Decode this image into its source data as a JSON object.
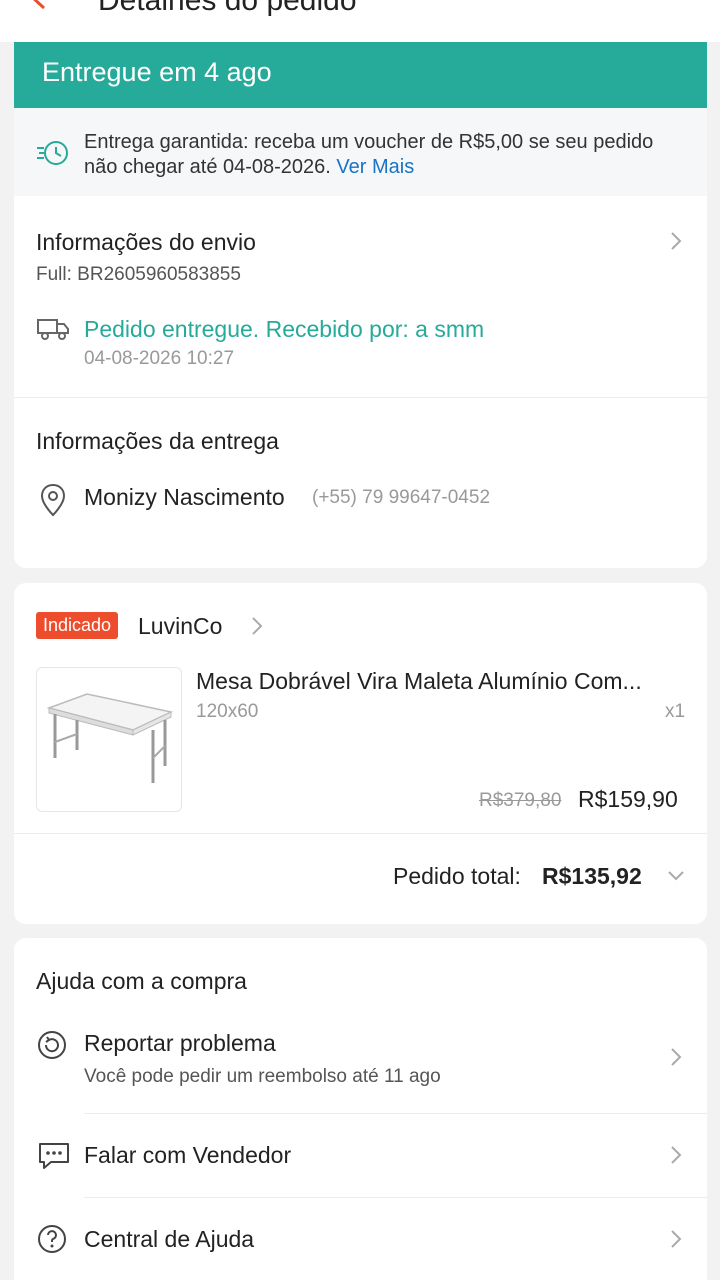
{
  "header": {
    "title": "Detalhes do pedido",
    "back_icon": "chevron-left-icon"
  },
  "status": {
    "text": "Entregue em 4 ago",
    "color": "#26aa99"
  },
  "guarantee": {
    "text": "Entrega garantida: receba um voucher de R$5,00 se seu pedido não chegar até 04-08-2026.",
    "link": "Ver Mais"
  },
  "shipping": {
    "title": "Informações do envio",
    "tracking": "Full: BR2605960583855",
    "event": "Pedido entregue. Recebido por: a smm",
    "event_time": "04-08-2026 10:27"
  },
  "delivery": {
    "title": "Informações da entrega",
    "name": "Monizy Nascimento",
    "phone": "(+55) 79 99647-0452"
  },
  "order": {
    "badge": "Indicado",
    "shop": "LuvinCo",
    "product": {
      "name": "Mesa Dobrável Vira Maleta Alumínio Com...",
      "variant": "120x60",
      "qty": "x1",
      "old_price": "R$379,80",
      "price": "R$159,90"
    },
    "total_label": "Pedido total:",
    "total_value": "R$135,92"
  },
  "help": {
    "title": "Ajuda com a compra",
    "items": [
      {
        "label": "Reportar problema",
        "sub": "Você pode pedir um reembolso até 11 ago"
      },
      {
        "label": "Falar com Vendedor"
      },
      {
        "label": "Central de Ajuda"
      }
    ]
  }
}
